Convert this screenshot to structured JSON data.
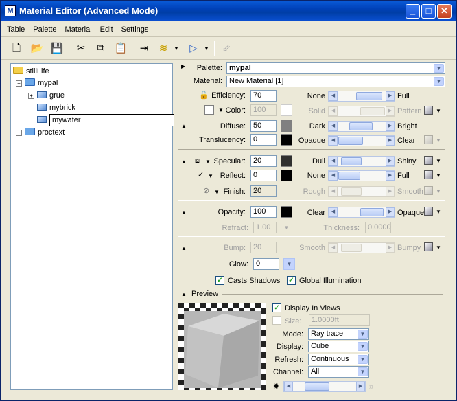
{
  "window": {
    "title": "Material Editor (Advanced Mode)",
    "app_icon": "M"
  },
  "menu": [
    "Table",
    "Palette",
    "Material",
    "Edit",
    "Settings"
  ],
  "toolbar_icons": [
    "new-icon",
    "open-icon",
    "save-icon",
    "cut-icon",
    "copy-icon",
    "paste-icon",
    "assign-icon",
    "layers-icon",
    "select-icon",
    "import-icon"
  ],
  "tree": {
    "root": "stillLife",
    "palette": "mypal",
    "materials": [
      "grue",
      "mybrick"
    ],
    "editing": "mywater",
    "other": "proctext"
  },
  "form": {
    "palette_label": "Palette:",
    "palette_value": "mypal",
    "material_label": "Material:",
    "material_value": "New Material [1]",
    "efficiency_label": "Efficiency:",
    "efficiency_value": "70",
    "efficiency_left": "None",
    "efficiency_right": "Full",
    "color_label": "Color:",
    "color_value": "100",
    "color_left": "Solid",
    "color_right": "Pattern",
    "diffuse_label": "Diffuse:",
    "diffuse_value": "50",
    "diffuse_left": "Dark",
    "diffuse_right": "Bright",
    "translucency_label": "Translucency:",
    "translucency_value": "0",
    "translucency_left": "Opaque",
    "translucency_right": "Clear",
    "specular_label": "Specular:",
    "specular_value": "20",
    "specular_left": "Dull",
    "specular_right": "Shiny",
    "reflect_label": "Reflect:",
    "reflect_value": "0",
    "reflect_left": "None",
    "reflect_right": "Full",
    "finish_label": "Finish:",
    "finish_value": "20",
    "finish_left": "Rough",
    "finish_right": "Smooth",
    "opacity_label": "Opacity:",
    "opacity_value": "100",
    "opacity_left": "Clear",
    "opacity_right": "Opaque",
    "refract_label": "Refract:",
    "refract_value": "1.00",
    "thickness_label": "Thickness:",
    "thickness_value": "0.0000",
    "bump_label": "Bump:",
    "bump_value": "20",
    "bump_left": "Smooth",
    "bump_right": "Bumpy",
    "glow_label": "Glow:",
    "glow_value": "0",
    "casts_shadows": "Casts Shadows",
    "global_illumination": "Global Illumination",
    "preview_label": "Preview",
    "display_in_views": "Display In Views",
    "size_label": "Size:",
    "size_value": "1.0000ft",
    "mode_label": "Mode:",
    "mode_value": "Ray trace",
    "display_label": "Display:",
    "display_value": "Cube",
    "refresh_label": "Refresh:",
    "refresh_value": "Continuous",
    "channel_label": "Channel:",
    "channel_value": "All"
  }
}
